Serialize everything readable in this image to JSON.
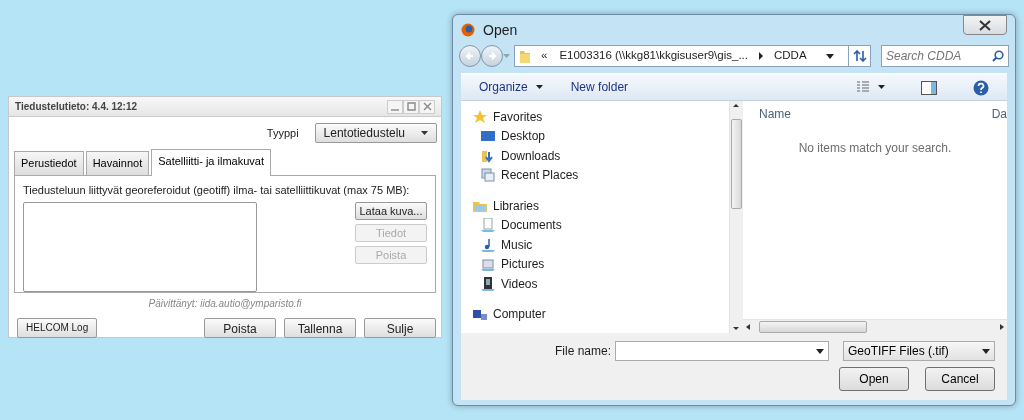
{
  "info_window": {
    "title": "Tiedustelutieto: 4.4. 12:12",
    "type_label": "Tyyppi",
    "type_value": "Lentotiedustelu",
    "tabs": [
      {
        "label": "Perustiedot",
        "selected": false
      },
      {
        "label": "Havainnot",
        "selected": false
      },
      {
        "label": "Satelliitti- ja ilmakuvat",
        "selected": true
      }
    ],
    "description": "Tiedusteluun liittyvät georeferoidut (geotiff) ilma- tai satelliittikuvat (max 75 MB):",
    "side_buttons": [
      {
        "label": "Lataa kuva...",
        "disabled": false
      },
      {
        "label": "Tiedot",
        "disabled": true
      },
      {
        "label": "Poista",
        "disabled": true
      }
    ],
    "updated_by": "Päivittänyt: iida.autio@ymparisto.fi",
    "left_button": "HELCOM Log",
    "footer_buttons": [
      "Poista",
      "Tallenna",
      "Sulje"
    ]
  },
  "open_dialog": {
    "title": "Open",
    "breadcrumb": [
      "«",
      "E1003316 (\\\\kkg81\\kkgisuser9\\gis_...",
      "CDDA"
    ],
    "search": {
      "placeholder": "Search CDDA"
    },
    "toolbar": [
      {
        "label": "Organize",
        "dropdown": true
      },
      {
        "label": "New folder",
        "dropdown": false
      }
    ],
    "nav": [
      {
        "label": "Favorites",
        "kind": "star",
        "children": [
          {
            "label": "Desktop",
            "kind": "desktop"
          },
          {
            "label": "Downloads",
            "kind": "download"
          },
          {
            "label": "Recent Places",
            "kind": "recent"
          }
        ]
      },
      {
        "label": "Libraries",
        "kind": "library",
        "children": [
          {
            "label": "Documents",
            "kind": "documents"
          },
          {
            "label": "Music",
            "kind": "music"
          },
          {
            "label": "Pictures",
            "kind": "pictures"
          },
          {
            "label": "Videos",
            "kind": "videos"
          }
        ]
      },
      {
        "label": "Computer",
        "kind": "computer"
      }
    ],
    "columns": [
      "Name",
      "Da"
    ],
    "empty_message": "No items match your search.",
    "file_name_label": "File name:",
    "file_type": "GeoTIFF Files (.tif)",
    "buttons": [
      "Open",
      "Cancel"
    ]
  }
}
